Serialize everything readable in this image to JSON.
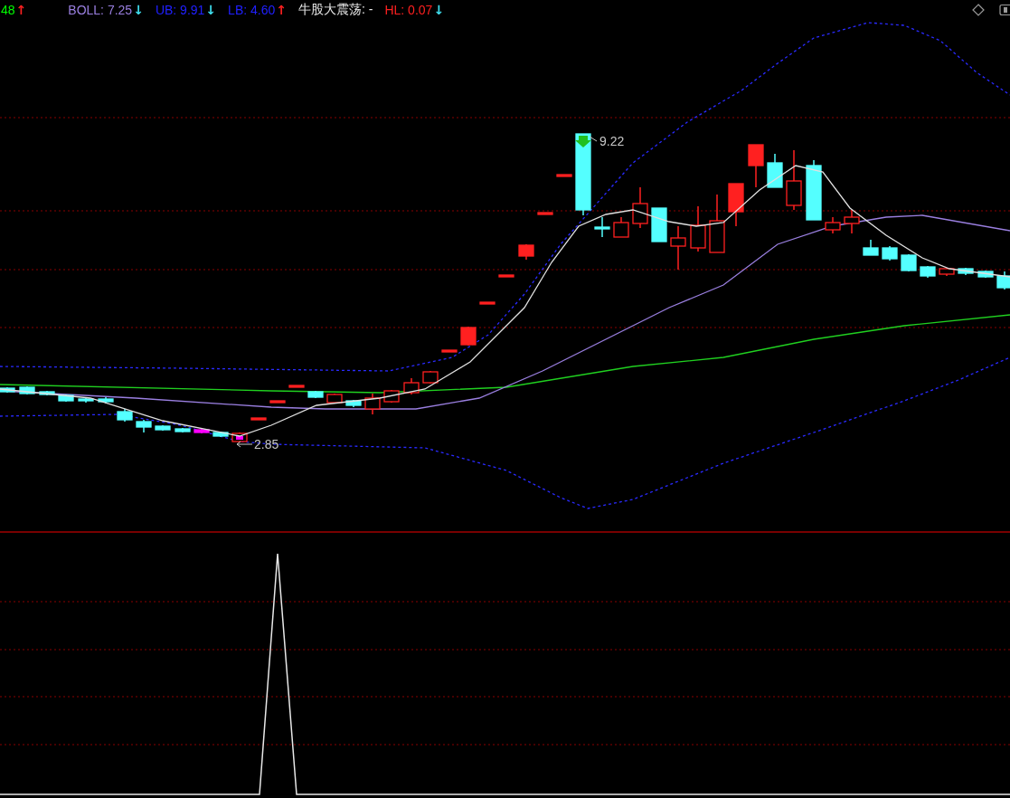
{
  "indicator_bar": {
    "items": [
      {
        "kind": "value",
        "text": "48",
        "color": "#00ff00"
      },
      {
        "kind": "arrow",
        "text": "↑",
        "color": "#ff2020"
      },
      {
        "kind": "value",
        "text": "BOLL: 7.25",
        "color": "#9a7fe0"
      },
      {
        "kind": "arrow",
        "text": "↓",
        "color": "#40e0f0"
      },
      {
        "kind": "value",
        "text": "UB: 9.91",
        "color": "#2020ff"
      },
      {
        "kind": "arrow",
        "text": "↓",
        "color": "#40e0f0"
      },
      {
        "kind": "value",
        "text": "LB: 4.60",
        "color": "#2020ff"
      },
      {
        "kind": "arrow",
        "text": "↑",
        "color": "#ff2020"
      },
      {
        "kind": "value",
        "text": "牛股大震荡: -",
        "color": "#e8e8e8"
      },
      {
        "kind": "value",
        "text": "HL: 0.07",
        "color": "#ff2020"
      },
      {
        "kind": "arrow",
        "text": "↓",
        "color": "#40e0f0"
      }
    ]
  },
  "price_chart": {
    "high_label": "9.22",
    "low_label": "2.85"
  }
}
